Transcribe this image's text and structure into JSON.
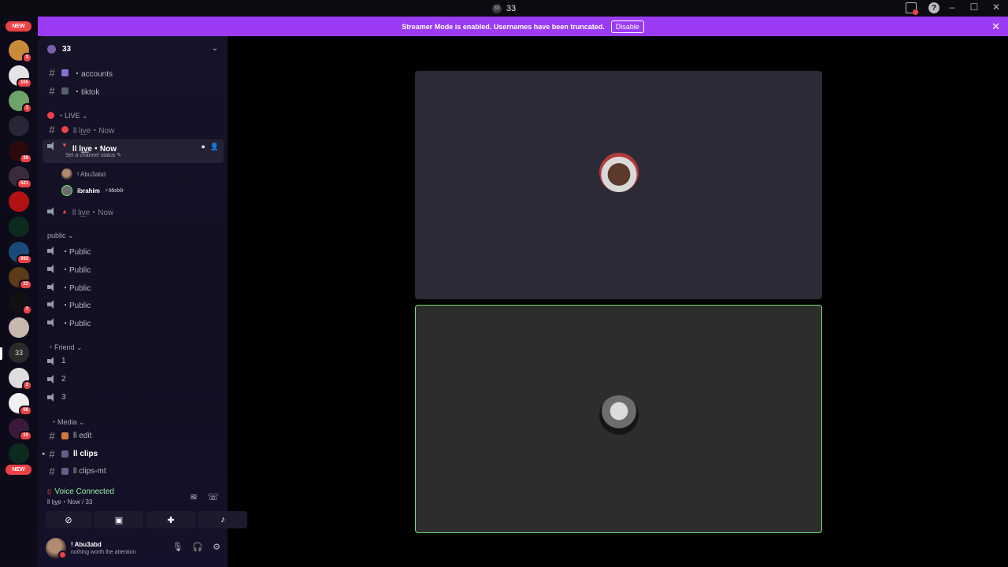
{
  "window": {
    "title": "33",
    "title_badge": "33",
    "controls": [
      "–",
      "☐",
      "✕"
    ]
  },
  "banner": {
    "message": "Streamer Mode is enabled. Usernames have been truncated.",
    "button": "Disable",
    "close": "✕"
  },
  "server_rail": {
    "new_top": "NEW",
    "new_bottom": "NEW",
    "badges": [
      "3",
      "105",
      "1",
      "26",
      "521",
      "992",
      "22",
      "7",
      "2",
      "68",
      "10"
    ],
    "server_33_label": "33"
  },
  "server": {
    "name": "33",
    "chevron": "⌄"
  },
  "channels": {
    "accounts": "・accounts",
    "tiktok": "・tiktok",
    "cat_live": "・LIVE ⌄",
    "live_text": "ll lι͟ve・Now",
    "live_voice_active": "ll lι͟ve・Now",
    "set_status": "Set a channel status ✎",
    "user1": "! Abu3abd",
    "user2": "ibrahim",
    "user2_tag": "⚡Mobb",
    "live_voice_2": "ll lι͟ve・Now",
    "cat_public": "public ⌄",
    "public": [
      "・Public",
      "・Public",
      "・Public",
      "・Public",
      "・Public"
    ],
    "cat_friend": "・Friend ⌄",
    "friend": [
      "1",
      "2",
      "3"
    ],
    "cat_media": "・Media ⌄",
    "edit": "ll edit",
    "clips": "ll clips",
    "clips_mt": "ll clips-mt"
  },
  "voice": {
    "title": "Voice Connected",
    "subtitle": "ll lι͟ve・Now / 33"
  },
  "user_panel": {
    "name": "! Abu3abd",
    "status": "nothing worth the attention"
  },
  "colors": {
    "banner": "#9b3bf4",
    "speaking_border": "#71e071",
    "accent_red": "#ed4245",
    "voice_green": "#8ff0a4"
  }
}
